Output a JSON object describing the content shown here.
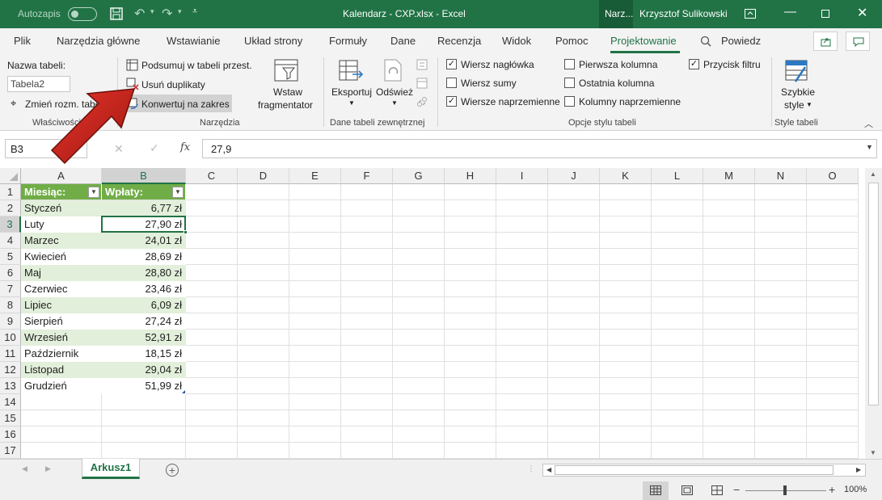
{
  "titlebar": {
    "autosave_label": "Autozapis",
    "autosave_state": "Wył.",
    "title": "Kalendarz - CXP.xlsx  -  Excel",
    "context_tab": "Narz...",
    "user": "Krzysztof Sulikowski"
  },
  "tabs": [
    "Plik",
    "Narzędzia główne",
    "Wstawianie",
    "Układ strony",
    "Formuły",
    "Dane",
    "Recenzja",
    "Widok",
    "Pomoc",
    "Projektowanie"
  ],
  "search_label": "Powiedz",
  "ribbon": {
    "properties": {
      "name_label": "Nazwa tabeli:",
      "name_value": "Tabela2",
      "resize_label": "Zmień rozm. tabeli",
      "group": "Właściwości"
    },
    "tools": {
      "pivot": "Podsumuj w tabeli przest.",
      "dedupe": "Usuń duplikaty",
      "convert": "Konwertuj na zakres",
      "slicer_line1": "Wstaw",
      "slicer_line2": "fragmentator",
      "group": "Narzędzia"
    },
    "external": {
      "export": "Eksportuj",
      "refresh": "Odśwież",
      "group": "Dane tabeli zewnętrznej"
    },
    "style_options": {
      "header_row": "Wiersz nagłówka",
      "total_row": "Wiersz sumy",
      "banded_rows": "Wiersze naprzemienne",
      "first_column": "Pierwsza kolumna",
      "last_column": "Ostatnia kolumna",
      "banded_columns": "Kolumny naprzemienne",
      "filter_button": "Przycisk filtru",
      "group": "Opcje stylu tabeli"
    },
    "styles": {
      "quick_line1": "Szybkie",
      "quick_line2": "style",
      "group": "Style tabeli"
    }
  },
  "formula_bar": {
    "name_box": "B3",
    "fx": "fx",
    "value": "27,9"
  },
  "columns": [
    "A",
    "B",
    "C",
    "D",
    "E",
    "F",
    "G",
    "H",
    "I",
    "J",
    "K",
    "L",
    "M",
    "N",
    "O"
  ],
  "rows": [
    "1",
    "2",
    "3",
    "4",
    "5",
    "6",
    "7",
    "8",
    "9",
    "10",
    "11",
    "12",
    "13",
    "14",
    "15",
    "16",
    "17"
  ],
  "table": {
    "headers": [
      "Miesiąc:",
      "Wpłaty:"
    ],
    "data": [
      [
        "Styczeń",
        "6,77 zł"
      ],
      [
        "Luty",
        "27,90 zł"
      ],
      [
        "Marzec",
        "24,01 zł"
      ],
      [
        "Kwiecień",
        "28,69 zł"
      ],
      [
        "Maj",
        "28,80 zł"
      ],
      [
        "Czerwiec",
        "23,46 zł"
      ],
      [
        "Lipiec",
        "6,09 zł"
      ],
      [
        "Sierpień",
        "27,24 zł"
      ],
      [
        "Wrzesień",
        "52,91 zł"
      ],
      [
        "Październik",
        "18,15 zł"
      ],
      [
        "Listopad",
        "29,04 zł"
      ],
      [
        "Grudzień",
        "51,99 zł"
      ]
    ]
  },
  "sheet_tab": "Arkusz1",
  "zoom": "100%",
  "colors": {
    "accent": "#217346",
    "table_header": "#70ad47",
    "band": "#e2efda",
    "arrow": "#c0201a"
  }
}
